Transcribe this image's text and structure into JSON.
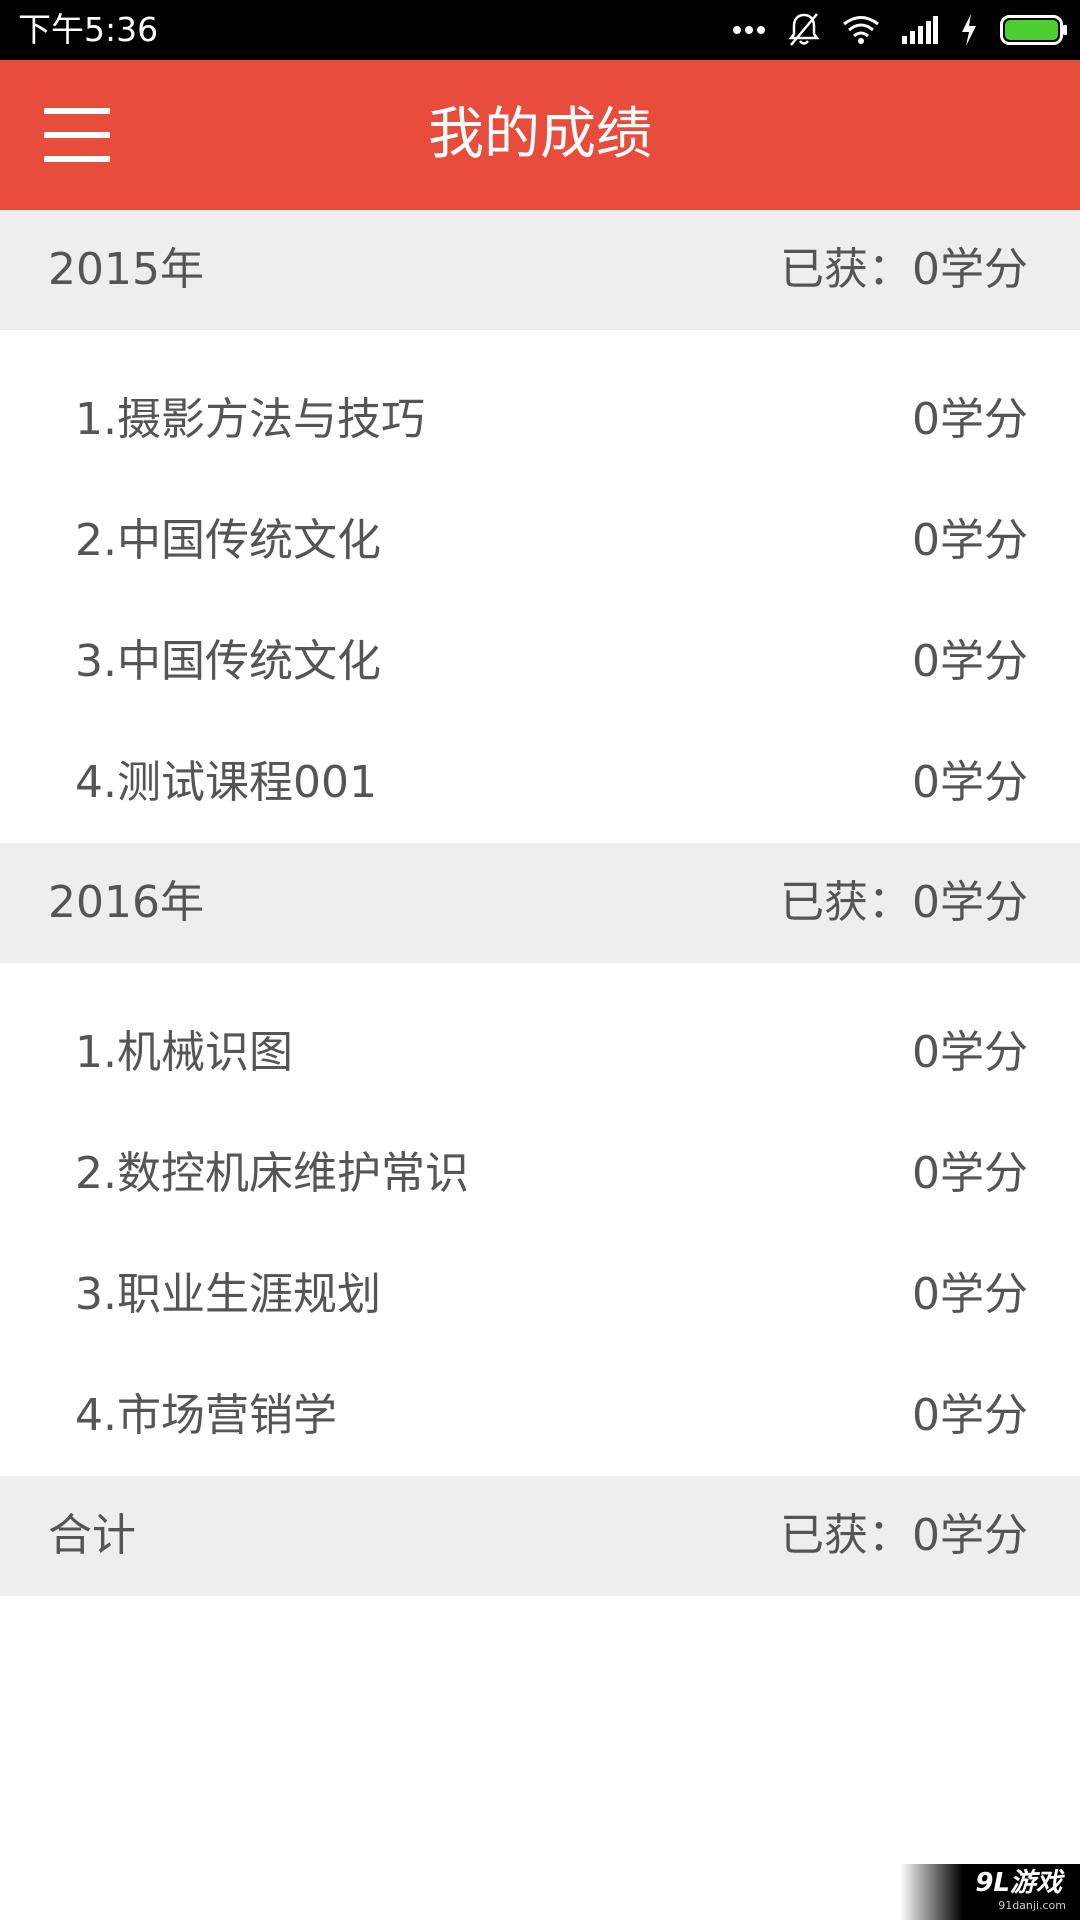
{
  "status_bar": {
    "time": "下午5:36",
    "icons": [
      "more-dots-icon",
      "bell-off-icon",
      "wifi-icon",
      "signal-icon",
      "charging-bolt-icon",
      "battery-icon"
    ]
  },
  "app_bar": {
    "title": "我的成绩",
    "menu_icon": "hamburger-menu-icon",
    "color": "#e84c3d"
  },
  "sections": [
    {
      "year": "2015年",
      "earned": "已获：0学分",
      "courses": [
        {
          "name": "1.摄影方法与技巧",
          "credit": "0学分"
        },
        {
          "name": "2.中国传统文化",
          "credit": "0学分"
        },
        {
          "name": "3.中国传统文化",
          "credit": "0学分"
        },
        {
          "name": "4.测试课程001",
          "credit": "0学分"
        }
      ]
    },
    {
      "year": "2016年",
      "earned": "已获：0学分",
      "courses": [
        {
          "name": "1.机械识图",
          "credit": "0学分"
        },
        {
          "name": "2.数控机床维护常识",
          "credit": "0学分"
        },
        {
          "name": "3.职业生涯规划",
          "credit": "0学分"
        },
        {
          "name": "4.市场营销学",
          "credit": "0学分"
        }
      ]
    }
  ],
  "total": {
    "label": "合计",
    "earned": "已获：0学分"
  },
  "watermark": {
    "logo": "9L游戏",
    "site": "91danji.com"
  }
}
